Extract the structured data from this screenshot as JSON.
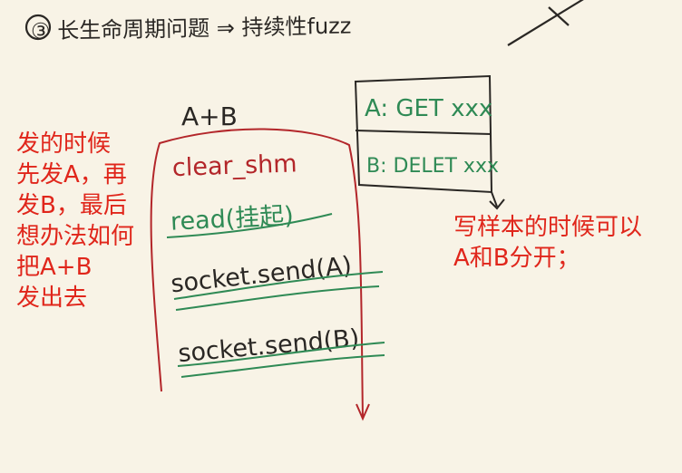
{
  "handwriting": {
    "heading": "③ 长生命周期问题 ⇒ 持续性fuzz",
    "stack_label": "A+B",
    "steps": [
      "clear_shm",
      "read(挂起)",
      "socket.send(A)",
      "socket.send(B)"
    ],
    "requests": [
      "A: GET xxx",
      "B: DELET xxx"
    ]
  },
  "left_note": {
    "lines": [
      "发的时候",
      "先发A，再",
      "发B，最后",
      "想办法如何",
      "把A+B",
      "发出去"
    ]
  },
  "right_note": {
    "lines": [
      "写样本的时候可以",
      "A和B分开；"
    ]
  },
  "colors": {
    "ink_black": "#2a2724",
    "ink_red": "#b3262a",
    "ink_green": "#2f8a55",
    "note_red": "#e0261b",
    "paper": "#f8f3e6"
  }
}
